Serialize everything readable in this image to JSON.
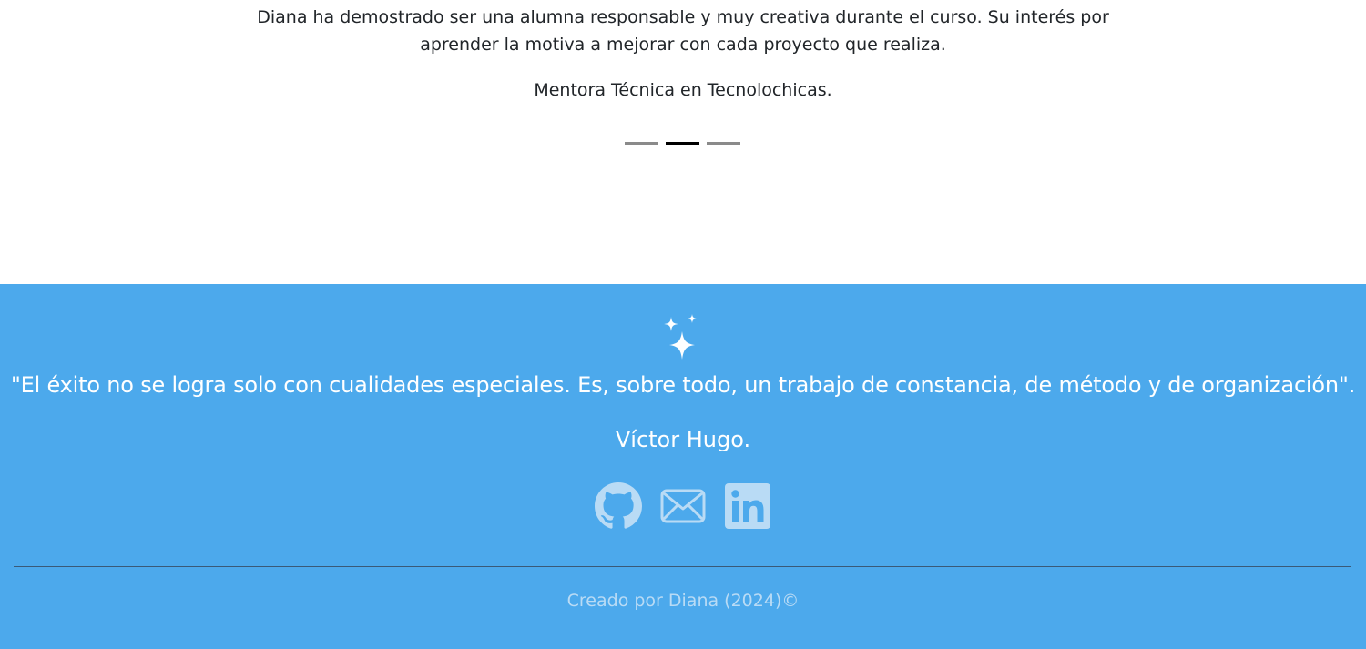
{
  "testimonial": {
    "text": "Diana ha demostrado ser una alumna responsable y muy creativa durante el curso. Su interés por aprender la motiva a mejorar con cada proyecto que realiza.",
    "author": "Mentora Técnica en Tecnolochicas.",
    "indicators": [
      {
        "active": false
      },
      {
        "active": true
      },
      {
        "active": false
      }
    ]
  },
  "footer": {
    "icon": "sparkles-icon",
    "quote": "\"El éxito no se logra solo con cualidades especiales. Es, sobre todo, un trabajo de constancia, de método y de organización\".",
    "quote_author": "Víctor Hugo.",
    "socials": [
      {
        "name": "github-icon"
      },
      {
        "name": "email-icon"
      },
      {
        "name": "linkedin-icon"
      }
    ],
    "credits": "Creado por Diana (2024)©"
  },
  "colors": {
    "footer_bg": "#4ca9ec",
    "icon_color": "#b9dbf5",
    "indicator_active": "#000000",
    "indicator_inactive": "#8a8a8a"
  }
}
